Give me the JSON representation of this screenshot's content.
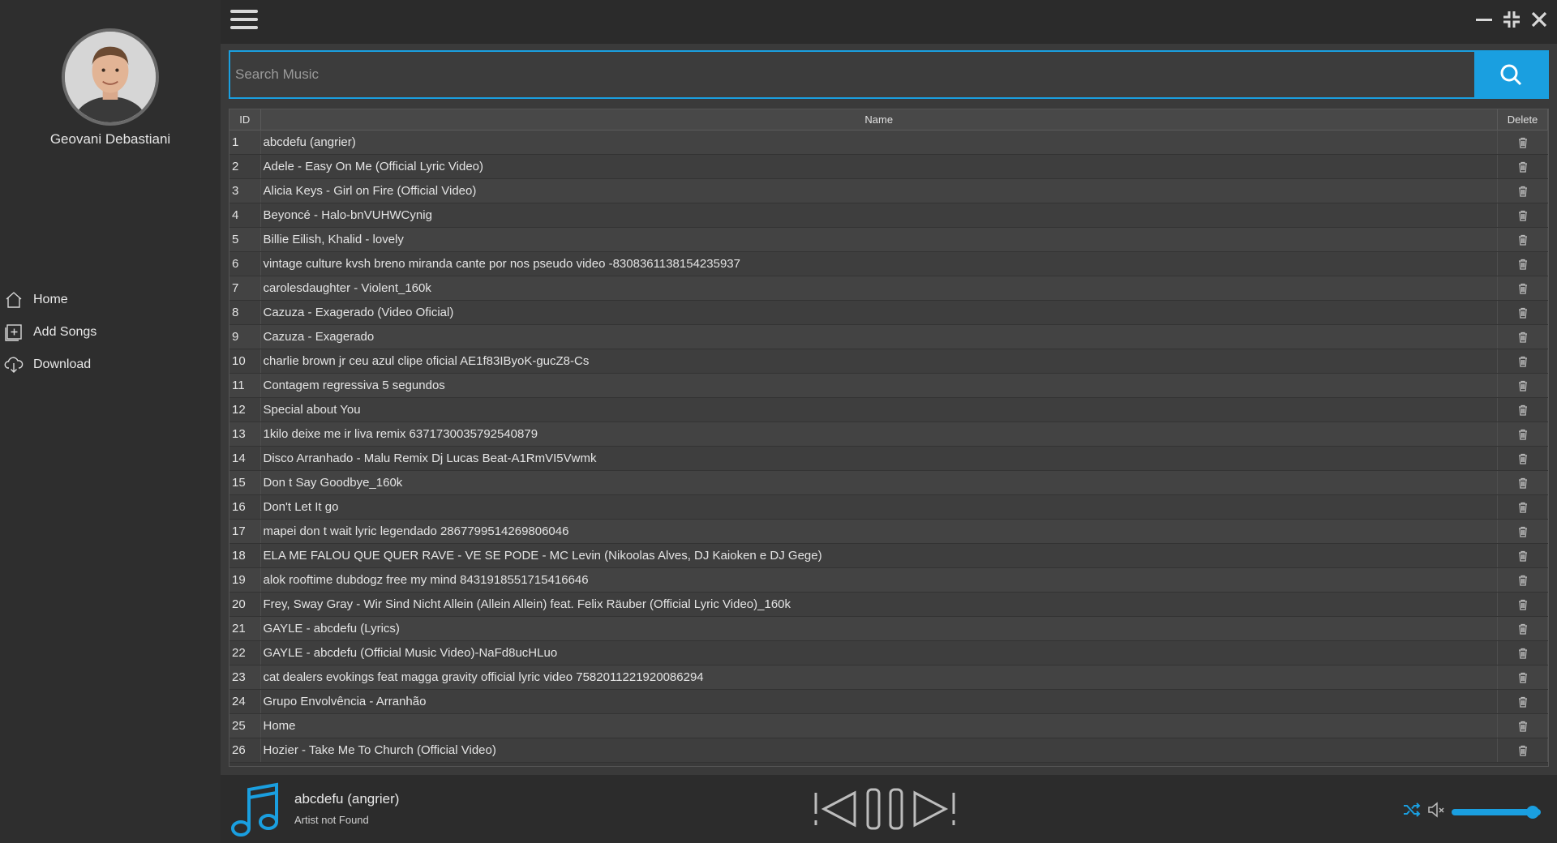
{
  "user": {
    "name": "Geovani Debastiani"
  },
  "nav": [
    {
      "label": "Home",
      "icon": "home-icon"
    },
    {
      "label": "Add Songs",
      "icon": "add-songs-icon"
    },
    {
      "label": "Download",
      "icon": "download-cloud-icon"
    }
  ],
  "search": {
    "placeholder": "Search Music",
    "value": ""
  },
  "table": {
    "headers": {
      "id": "ID",
      "name": "Name",
      "delete": "Delete"
    },
    "rows": [
      {
        "id": "1",
        "name": "abcdefu (angrier)"
      },
      {
        "id": "2",
        "name": "Adele - Easy On Me (Official Lyric Video)"
      },
      {
        "id": "3",
        "name": "Alicia Keys - Girl on Fire (Official Video)"
      },
      {
        "id": "4",
        "name": "Beyoncé - Halo-bnVUHWCynig"
      },
      {
        "id": "5",
        "name": "Billie Eilish, Khalid - lovely"
      },
      {
        "id": "6",
        "name": "vintage culture kvsh breno miranda cante por nos pseudo video -8308361138154235937"
      },
      {
        "id": "7",
        "name": "carolesdaughter - Violent_160k"
      },
      {
        "id": "8",
        "name": "Cazuza - Exagerado (Video Oficial)"
      },
      {
        "id": "9",
        "name": "Cazuza - Exagerado"
      },
      {
        "id": "10",
        "name": "charlie brown jr ceu azul clipe oficial AE1f83IByoK-gucZ8-Cs"
      },
      {
        "id": "11",
        "name": "Contagem regressiva 5 segundos"
      },
      {
        "id": "12",
        "name": "Special about You"
      },
      {
        "id": "13",
        "name": "1kilo deixe me ir liva remix 6371730035792540879"
      },
      {
        "id": "14",
        "name": "Disco Arranhado - Malu Remix Dj Lucas Beat-A1RmVI5Vwmk"
      },
      {
        "id": "15",
        "name": "Don t Say Goodbye_160k"
      },
      {
        "id": "16",
        "name": "Don't Let It go"
      },
      {
        "id": "17",
        "name": "mapei don t wait lyric legendado 2867799514269806046"
      },
      {
        "id": "18",
        "name": "ELA ME FALOU QUE QUER RAVE - VE SE PODE - MC Levin (Nikoolas Alves, DJ Kaioken e DJ Gege)"
      },
      {
        "id": "19",
        "name": "alok rooftime dubdogz free my mind 8431918551715416646"
      },
      {
        "id": "20",
        "name": "Frey, Sway Gray - Wir Sind Nicht Allein (Allein Allein) feat. Felix Räuber (Official Lyric Video)_160k"
      },
      {
        "id": "21",
        "name": "GAYLE - abcdefu (Lyrics)"
      },
      {
        "id": "22",
        "name": "GAYLE - abcdefu (Official Music Video)-NaFd8ucHLuo"
      },
      {
        "id": "23",
        "name": "cat dealers evokings feat magga gravity official lyric video 7582011221920086294"
      },
      {
        "id": "24",
        "name": "Grupo Envolvência - Arranhão"
      },
      {
        "id": "25",
        "name": "Home"
      },
      {
        "id": "26",
        "name": "Hozier - Take Me To Church (Official Video)"
      }
    ]
  },
  "player": {
    "title": "abcdefu (angrier)",
    "artist": "Artist not Found",
    "volume": 1.0
  },
  "colors": {
    "accent": "#1a9fe0",
    "background": "#2b2b2b",
    "panel": "#3a3a3a"
  }
}
